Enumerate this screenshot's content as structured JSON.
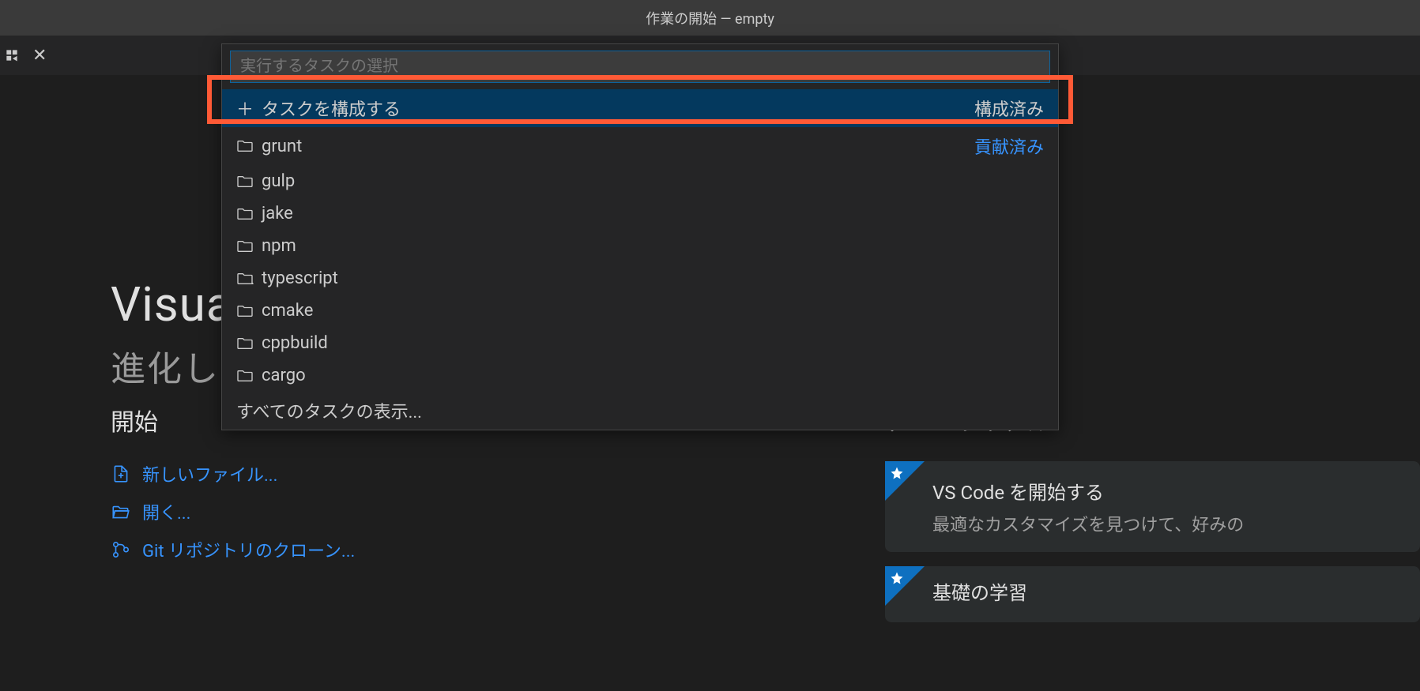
{
  "titlebar": {
    "title": "作業の開始 — empty"
  },
  "welcome": {
    "title": "Visua",
    "subtitle": "進化し",
    "start_heading": "開始",
    "links": {
      "new_file": "新しいファイル...",
      "open": "開く...",
      "clone_repo": "Git リポジトリのクローン..."
    },
    "tutorial_heading": "チュートリアル",
    "tutorials": [
      {
        "title": "VS Code を開始する",
        "desc": "最適なカスタマイズを見つけて、好みの"
      },
      {
        "title": "基礎の学習",
        "desc": ""
      }
    ]
  },
  "quickpick": {
    "placeholder": "実行するタスクの選択",
    "configure_task": "タスクを構成する",
    "configured_badge": "構成済み",
    "contributed_badge": "貢献済み",
    "items": [
      {
        "label": "grunt"
      },
      {
        "label": "gulp"
      },
      {
        "label": "jake"
      },
      {
        "label": "npm"
      },
      {
        "label": "typescript"
      },
      {
        "label": "cmake"
      },
      {
        "label": "cppbuild"
      },
      {
        "label": "cargo"
      }
    ],
    "show_all": "すべてのタスクの表示..."
  }
}
